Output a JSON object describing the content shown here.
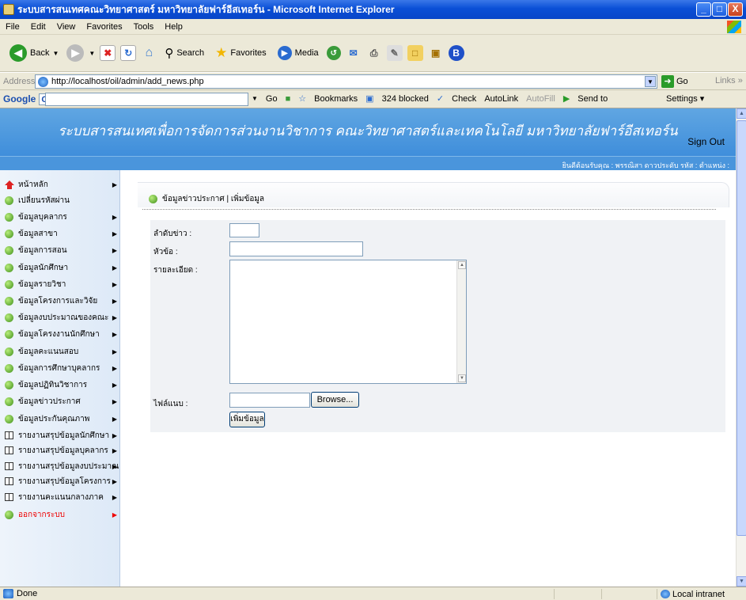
{
  "window": {
    "title": "ระบบสารสนเทศคณะวิทยาศาสตร์ มหาวิทยาลัยฟาร์อีสเทอร์น - Microsoft Internet Explorer",
    "controls": [
      "_",
      "□",
      "X"
    ]
  },
  "menu": [
    "File",
    "Edit",
    "View",
    "Favorites",
    "Tools",
    "Help"
  ],
  "toolbar": {
    "back": "Back",
    "search": "Search",
    "favorites": "Favorites",
    "media": "Media"
  },
  "address": {
    "label": "Address",
    "url": "http://localhost/oil/admin/add_news.php",
    "go": "Go",
    "links": "Links"
  },
  "googlebar": {
    "logo": "Google",
    "go": "Go",
    "bookmarks": "Bookmarks",
    "blocked": "324 blocked",
    "check": "Check",
    "autolink": "AutoLink",
    "autofill": "AutoFill",
    "sendto": "Send to",
    "settings": "Settings"
  },
  "header": {
    "title": "ระบบสารสนเทศเพื่อการจัดการส่วนงานวิชาการ คณะวิทยาศาสตร์และเทคโนโลยี มหาวิทยาลัยฟาร์อีสเทอร์น",
    "signout": "Sign Out",
    "welcome": "ยินดีต้อนรับคุณ : พรรณิสา ดาวประดับ รหัส : ตำแหน่ง :"
  },
  "sidebar": [
    {
      "label": "หน้าหลัก",
      "icon": "home-icon",
      "arrow": true
    },
    {
      "label": "เปลี่ยนรหัสผ่าน",
      "icon": "green-bullet-icon",
      "arrow": false
    },
    {
      "label": "ข้อมูลบุคลากร",
      "icon": "green-bullet-icon",
      "arrow": true
    },
    {
      "label": "ข้อมูลสาขา",
      "icon": "green-bullet-icon",
      "arrow": true
    },
    {
      "label": "ข้อมูลการสอน",
      "icon": "green-bullet-icon",
      "arrow": true
    },
    {
      "label": "ข้อมูลนักศึกษา",
      "icon": "green-bullet-icon",
      "arrow": true
    },
    {
      "label": "ข้อมูลรายวิชา",
      "icon": "green-bullet-icon",
      "arrow": true
    },
    {
      "label": "ข้อมูลโครงการและวิจัย",
      "icon": "green-bullet-icon",
      "arrow": true
    },
    {
      "label": "ข้อมูลงบประมาณของคณะ",
      "icon": "green-bullet-icon",
      "arrow": true
    },
    {
      "label": "ข้อมูลโครงงานนักศึกษา",
      "icon": "green-bullet-icon",
      "arrow": true
    },
    {
      "label": "ข้อมูลคะแนนสอบ",
      "icon": "green-bullet-icon",
      "arrow": true
    },
    {
      "label": "ข้อมูลการศึกษาบุคลากร",
      "icon": "green-bullet-icon",
      "arrow": true
    },
    {
      "label": "ข้อมูลปฏิทินวิชาการ",
      "icon": "green-bullet-icon",
      "arrow": true
    },
    {
      "label": "ข้อมูลข่าวประกาศ",
      "icon": "green-bullet-icon",
      "arrow": true
    },
    {
      "label": "ข้อมูลประกันคุณภาพ",
      "icon": "green-bullet-icon",
      "arrow": true
    },
    {
      "label": "รายงานสรุปข้อมูลนักศึกษา",
      "icon": "book-icon",
      "arrow": true
    },
    {
      "label": "รายงานสรุปข้อมูลบุคลากร",
      "icon": "book-icon",
      "arrow": true
    },
    {
      "label": "รายงานสรุปข้อมูลงบประมาณ",
      "icon": "book-icon",
      "arrow": true
    },
    {
      "label": "รายงานสรุปข้อมูลโครงการ",
      "icon": "book-icon",
      "arrow": true
    },
    {
      "label": "รายงานคะแนนกลางภาค",
      "icon": "book-icon",
      "arrow": true
    },
    {
      "label": "ออกจากระบบ",
      "icon": "green-bullet-icon",
      "arrow": true,
      "red": true
    }
  ],
  "breadcrumb": "ข้อมูลข่าวประกาศ | เพิ่มข้อมูล",
  "form": {
    "order_label": "ลำดับข่าว :",
    "order_value": "",
    "subject_label": "หัวข้อ :",
    "subject_value": "",
    "detail_label": "รายละเอียด :",
    "detail_value": "",
    "attach_label": "ไฟล์แนบ :",
    "attach_value": "",
    "browse": "Browse...",
    "submit": "เพิ่มข้อมูล"
  },
  "status": {
    "text": "Done",
    "zone": "Local intranet"
  }
}
